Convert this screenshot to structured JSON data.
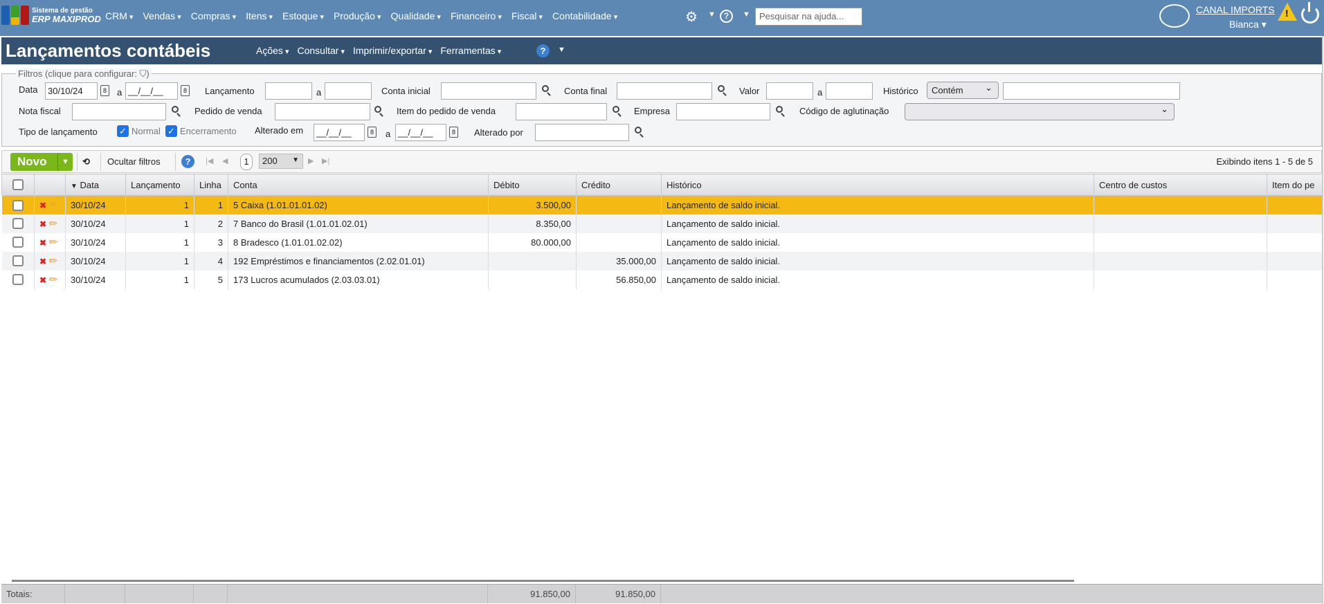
{
  "app": {
    "logo_line1": "Sistema de gestão",
    "logo_line2": "ERP MAXIPROD",
    "menu": [
      "CRM",
      "Vendas",
      "Compras",
      "Itens",
      "Estoque",
      "Produção",
      "Qualidade",
      "Financeiro",
      "Fiscal",
      "Contabilidade"
    ],
    "help_search_placeholder": "Pesquisar na ajuda...",
    "company": "CANAL IMPORTS",
    "user": "Bianca"
  },
  "page": {
    "title": "Lançamentos contábeis",
    "menu": [
      "Ações",
      "Consultar",
      "Imprimir/exportar",
      "Ferramentas"
    ]
  },
  "filters": {
    "legend": "Filtros (clique para configurar:",
    "data_label": "Data",
    "data_from": "30/10/24",
    "data_to": "__/__/__",
    "a": "a",
    "lancamento_label": "Lançamento",
    "conta_inicial_label": "Conta inicial",
    "conta_final_label": "Conta final",
    "valor_label": "Valor",
    "historico_label": "Histórico",
    "historico_op": "Contém",
    "nota_fiscal_label": "Nota fiscal",
    "pedido_label": "Pedido de venda",
    "item_pedido_label": "Item do pedido de venda",
    "empresa_label": "Empresa",
    "codigo_label": "Código de aglutinação",
    "tipo_label": "Tipo de lançamento",
    "normal_label": "Normal",
    "encerramento_label": "Encerramento",
    "alterado_em_label": "Alterado em",
    "alterado_em_from": "__/__/__",
    "alterado_em_to": "__/__/__",
    "alterado_por_label": "Alterado por"
  },
  "toolbar": {
    "novo": "Novo",
    "hide_filters": "Ocultar filtros",
    "page": "1",
    "page_size": "200",
    "summary": "Exibindo itens 1 - 5 de 5"
  },
  "table": {
    "columns": [
      "Data",
      "Lançamento",
      "Linha",
      "Conta",
      "Débito",
      "Crédito",
      "Histórico",
      "Centro de custos",
      "Item do pe"
    ],
    "rows": [
      {
        "data": "30/10/24",
        "lanc": "1",
        "linha": "1",
        "conta": "5 Caixa (1.01.01.01.02)",
        "debito": "3.500,00",
        "credito": "",
        "hist": "Lançamento de saldo inicial."
      },
      {
        "data": "30/10/24",
        "lanc": "1",
        "linha": "2",
        "conta": "7 Banco do Brasil (1.01.01.02.01)",
        "debito": "8.350,00",
        "credito": "",
        "hist": "Lançamento de saldo inicial."
      },
      {
        "data": "30/10/24",
        "lanc": "1",
        "linha": "3",
        "conta": "8 Bradesco (1.01.01.02.02)",
        "debito": "80.000,00",
        "credito": "",
        "hist": "Lançamento de saldo inicial."
      },
      {
        "data": "30/10/24",
        "lanc": "1",
        "linha": "4",
        "conta": "192 Empréstimos e financiamentos (2.02.01.01)",
        "debito": "",
        "credito": "35.000,00",
        "hist": "Lançamento de saldo inicial."
      },
      {
        "data": "30/10/24",
        "lanc": "1",
        "linha": "5",
        "conta": "173 Lucros acumulados (2.03.03.01)",
        "debito": "",
        "credito": "56.850,00",
        "hist": "Lançamento de saldo inicial."
      }
    ],
    "totals_label": "Totais:",
    "total_debito": "91.850,00",
    "total_credito": "91.850,00"
  }
}
